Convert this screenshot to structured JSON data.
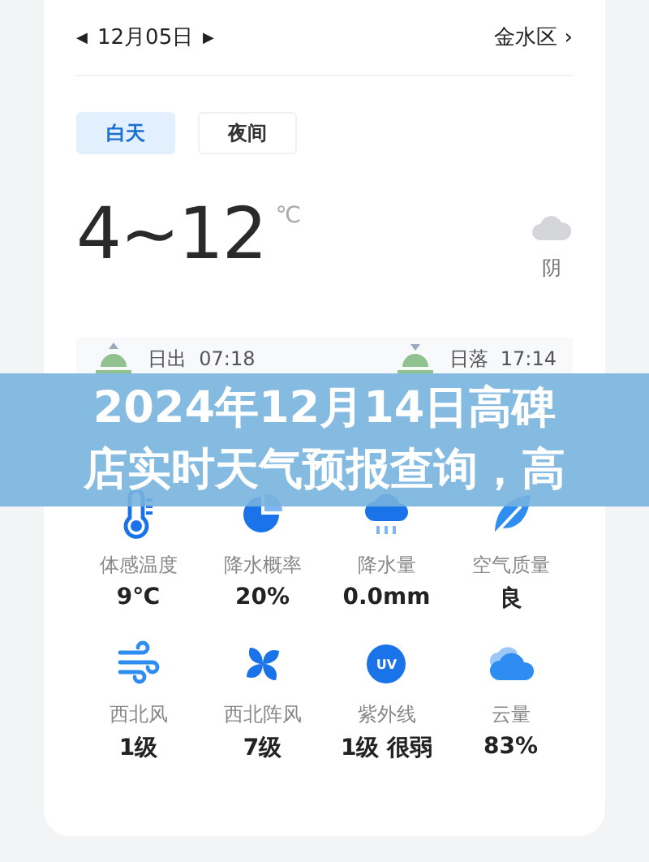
{
  "header": {
    "prev": "◀",
    "date": "12月05日",
    "next": "▶",
    "location": "金水区",
    "location_arrow": "›"
  },
  "tabs": [
    {
      "label": "白天",
      "selected": true
    },
    {
      "label": "夜间",
      "selected": false
    }
  ],
  "temperature": {
    "range": "4~12",
    "unit": "℃",
    "condition": "阴"
  },
  "sun": [
    {
      "kind": "sunrise",
      "label": "日出",
      "time": "07:18"
    },
    {
      "kind": "sunset",
      "label": "日落",
      "time": "17:14"
    }
  ],
  "banner": {
    "lines": [
      "2024年12月14日高碑",
      "店实时天气预报查询，高"
    ]
  },
  "metrics": [
    {
      "kind": "thermometer",
      "label": "体感温度",
      "value": "9℃"
    },
    {
      "kind": "pie",
      "label": "降水概率",
      "value": "20%"
    },
    {
      "kind": "rain",
      "label": "降水量",
      "value": "0.0mm"
    },
    {
      "kind": "leaf",
      "label": "空气质量",
      "value": "良"
    },
    {
      "kind": "wind",
      "label": "西北风",
      "value": "1级"
    },
    {
      "kind": "pinwheel",
      "label": "西北阵风",
      "value": "7级"
    },
    {
      "kind": "uv",
      "icon_text": "UV",
      "label": "紫外线",
      "value": "1级 很弱"
    },
    {
      "kind": "cloud",
      "label": "云量",
      "value": "83%"
    }
  ]
}
